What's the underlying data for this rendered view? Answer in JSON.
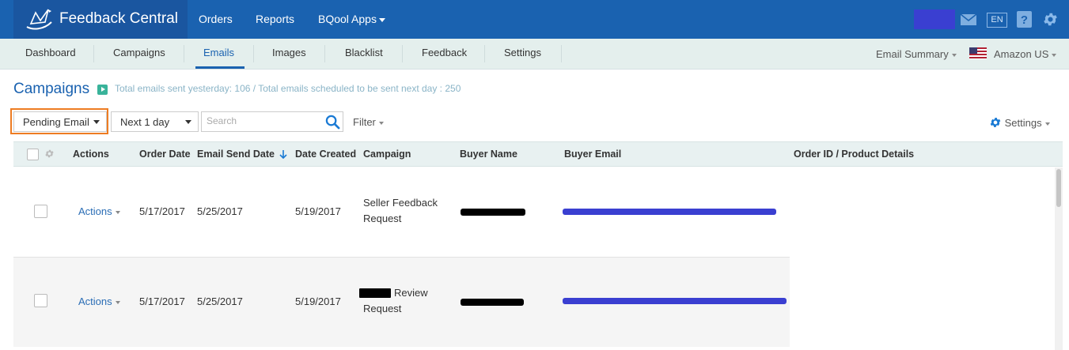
{
  "header": {
    "brand": "Feedback Central",
    "nav": [
      "Orders",
      "Reports",
      "BQool Apps"
    ],
    "lang": "EN"
  },
  "subnav": {
    "items": [
      "Dashboard",
      "Campaigns",
      "Emails",
      "Images",
      "Blacklist",
      "Feedback",
      "Settings"
    ],
    "active": "Emails",
    "email_summary": "Email Summary",
    "marketplace": "Amazon US"
  },
  "page": {
    "title": "Campaigns",
    "stats": "Total emails sent yesterday: 106 / Total emails scheduled to be sent next day : 250"
  },
  "toolbar": {
    "status_select": "Pending Email",
    "range_select": "Next 1 day",
    "search_placeholder": "Search",
    "filter_label": "Filter",
    "settings_label": "Settings"
  },
  "table": {
    "columns": [
      "Actions",
      "Order Date",
      "Email Send Date",
      "Date Created",
      "Campaign",
      "Buyer Name",
      "Buyer Email",
      "Order ID / Product Details"
    ],
    "sort_column": "Email Send Date",
    "rows": [
      {
        "actions": "Actions",
        "order_date": "5/17/2017",
        "send_date": "5/25/2017",
        "created": "5/19/2017",
        "campaign_line1": "Seller Feedback",
        "campaign_line2": "Request"
      },
      {
        "actions": "Actions",
        "order_date": "5/17/2017",
        "send_date": "5/25/2017",
        "created": "5/19/2017",
        "campaign_line1": "Review",
        "campaign_line2": "Request"
      }
    ]
  },
  "colors": {
    "header_bg": "#1a62b0",
    "subnav_bg": "#e4efed",
    "accent": "#1a62b0",
    "highlight": "#ee7c22",
    "redaction_blue": "#3a3fd1"
  }
}
